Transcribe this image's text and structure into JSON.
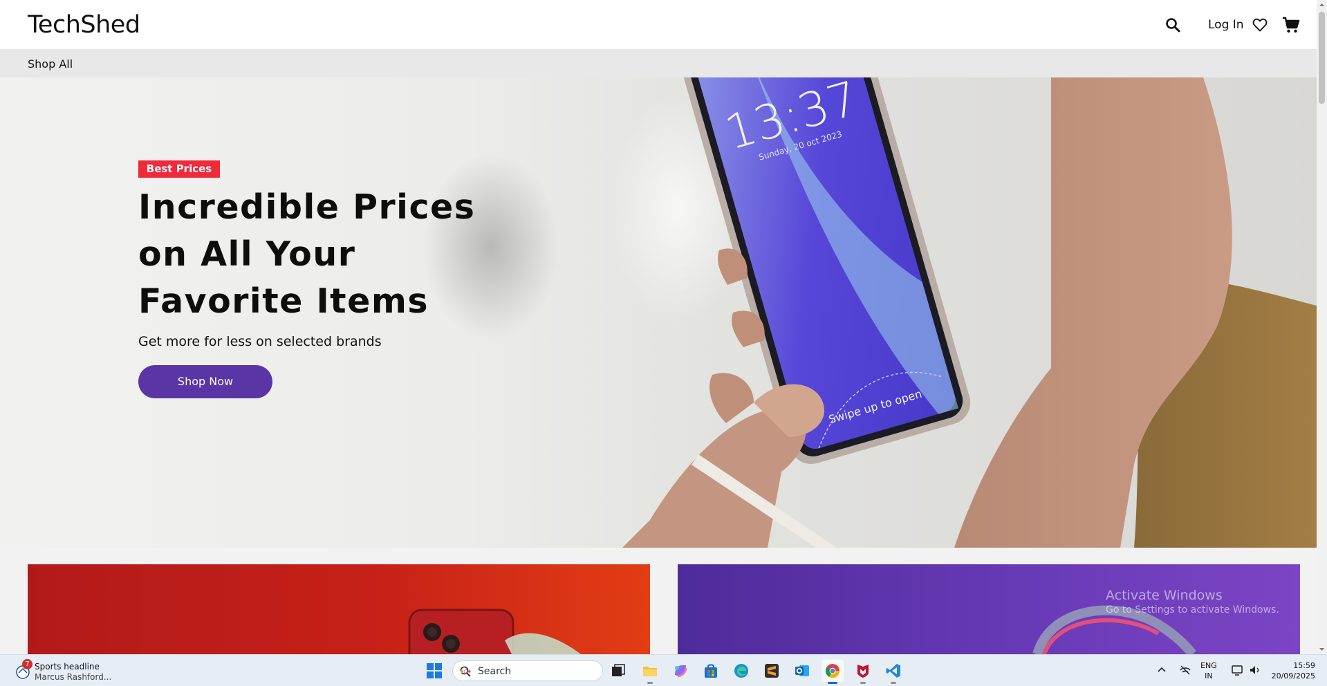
{
  "header": {
    "logo": "TechShed",
    "login_label": "Log In",
    "icons": [
      "search-icon",
      "heart-icon",
      "cart-icon"
    ]
  },
  "nav": {
    "shop_all": "Shop All"
  },
  "hero": {
    "badge": "Best Prices",
    "title_lines": [
      "Incredible Prices",
      "on All Your",
      "Favorite Items"
    ],
    "subtitle": "Get more for less on selected brands",
    "cta": "Shop Now",
    "phone_time": "13:37",
    "phone_date": "Sunday, 20 oct 2023",
    "phone_swipe": "Swipe up to open"
  },
  "watermark": {
    "line1": "Activate Windows",
    "line2": "Go to Settings to activate Windows."
  },
  "taskbar": {
    "news_badge": "7",
    "news_title": "Sports headline",
    "news_sub": "Marcus Rashford...",
    "search_placeholder": "Search",
    "lang_line1": "ENG",
    "lang_line2": "IN",
    "time": "15:59",
    "date": "20/09/2025"
  },
  "colors": {
    "accent_purple": "#5a35a6",
    "badge_red": "#ee2a3b",
    "card_red": "#c62018",
    "card_purple": "#6a3bb8"
  }
}
